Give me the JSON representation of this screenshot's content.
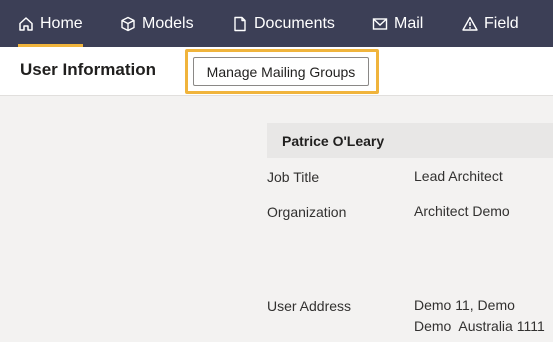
{
  "nav": {
    "items": [
      {
        "label": "Home",
        "icon": "home-icon",
        "active": true
      },
      {
        "label": "Models",
        "icon": "cube-icon"
      },
      {
        "label": "Documents",
        "icon": "document-icon"
      },
      {
        "label": "Mail",
        "icon": "mail-icon"
      },
      {
        "label": "Field",
        "icon": "warning-icon"
      }
    ]
  },
  "header": {
    "title": "User Information",
    "manage_button": "Manage Mailing Groups"
  },
  "user": {
    "name": "Patrice O'Leary",
    "fields": [
      {
        "label": "Job Title",
        "value": "Lead Architect"
      },
      {
        "label": "Organization",
        "value": "Architect Demo"
      },
      {
        "label": "User Address",
        "value_line1": "Demo 11, Demo",
        "value_line2": "Demo  Australia 1111"
      }
    ]
  },
  "colors": {
    "nav_bg": "#3c3f56",
    "accent": "#f0b43c"
  }
}
